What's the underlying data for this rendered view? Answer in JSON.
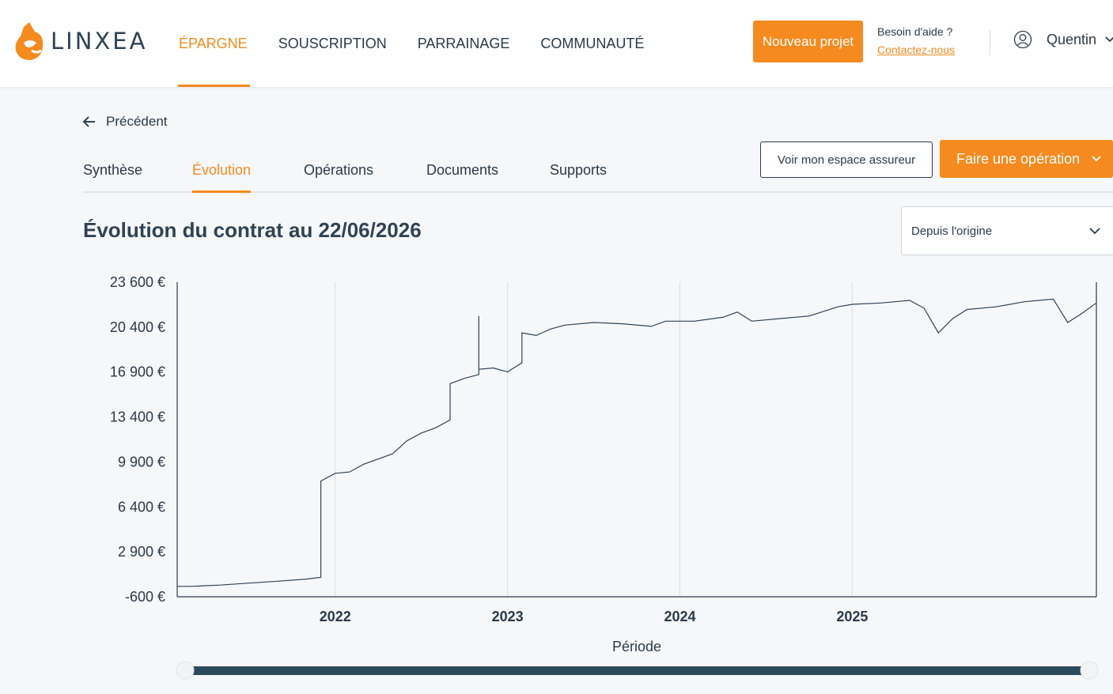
{
  "header": {
    "logo_text": "LINXEA",
    "nav": [
      "ÉPARGNE",
      "SOUSCRIPTION",
      "PARRAINAGE",
      "COMMUNAUTÉ"
    ],
    "new_project": "Nouveau projet",
    "help_title": "Besoin d'aide ?",
    "help_link": "Contactez-nous",
    "user_name": "Quentin"
  },
  "back_label": "Précédent",
  "tabs": [
    "Synthèse",
    "Évolution",
    "Opérations",
    "Documents",
    "Supports"
  ],
  "active_tab": "Évolution",
  "buttons": {
    "insurer_space": "Voir mon espace assureur",
    "operation": "Faire une opération"
  },
  "page_title": "Évolution du contrat au 22/06/2026",
  "period_select": {
    "value": "Depuis l'origine"
  },
  "colors": {
    "accent": "#f58a1f",
    "line": "#2f4356",
    "slider": "#2c4a5e"
  },
  "icons": [
    "logo-fox-icon",
    "user-icon",
    "chevron-down-icon",
    "arrow-left-icon"
  ],
  "chart_data": {
    "type": "line",
    "xlabel": "Période",
    "x_ticks": [
      "2022",
      "2023",
      "2024",
      "2025"
    ],
    "y_ticks": [
      "23 600 €",
      "20 400 €",
      "16 900 €",
      "13 400 €",
      "9 900 €",
      "6 400 €",
      "2 900 €",
      "-600 €"
    ],
    "ylim": [
      -600,
      23600
    ],
    "x_range": [
      "2021-02",
      "2026-06"
    ],
    "grid": "vertical",
    "series": [
      {
        "values": [
          [
            "2021-02",
            200
          ],
          [
            "2021-03",
            200
          ],
          [
            "2021-05",
            300
          ],
          [
            "2021-07",
            450
          ],
          [
            "2021-09",
            600
          ],
          [
            "2021-11",
            760
          ],
          [
            "2021-12",
            900
          ],
          [
            "2021-12",
            8300
          ],
          [
            "2022-01",
            8900
          ],
          [
            "2022-02",
            9000
          ],
          [
            "2022-03",
            9600
          ],
          [
            "2022-04",
            10000
          ],
          [
            "2022-05",
            10400
          ],
          [
            "2022-06",
            11400
          ],
          [
            "2022-07",
            12000
          ],
          [
            "2022-08",
            12400
          ],
          [
            "2022-09",
            13000
          ],
          [
            "2022-09",
            15800
          ],
          [
            "2022-10",
            16200
          ],
          [
            "2022-11",
            16500
          ],
          [
            "2022-11",
            21000
          ],
          [
            "2022-11",
            16900
          ],
          [
            "2022-12",
            17000
          ],
          [
            "2023-01",
            16700
          ],
          [
            "2023-02",
            17400
          ],
          [
            "2023-02",
            19700
          ],
          [
            "2023-03",
            19500
          ],
          [
            "2023-04",
            20000
          ],
          [
            "2023-05",
            20300
          ],
          [
            "2023-07",
            20500
          ],
          [
            "2023-09",
            20400
          ],
          [
            "2023-11",
            20200
          ],
          [
            "2023-12",
            20600
          ],
          [
            "2024-02",
            20600
          ],
          [
            "2024-04",
            20900
          ],
          [
            "2024-05",
            21300
          ],
          [
            "2024-06",
            20600
          ],
          [
            "2024-08",
            20800
          ],
          [
            "2024-10",
            21000
          ],
          [
            "2024-12",
            21700
          ],
          [
            "2025-01",
            21900
          ],
          [
            "2025-03",
            22000
          ],
          [
            "2025-05",
            22200
          ],
          [
            "2025-06",
            21600
          ],
          [
            "2025-07",
            19700
          ],
          [
            "2025-08",
            20800
          ],
          [
            "2025-09",
            21500
          ],
          [
            "2025-11",
            21700
          ],
          [
            "2026-01",
            22100
          ],
          [
            "2026-03",
            22300
          ],
          [
            "2026-04",
            20500
          ],
          [
            "2026-05",
            21200
          ],
          [
            "2026-06",
            22000
          ]
        ]
      }
    ]
  }
}
